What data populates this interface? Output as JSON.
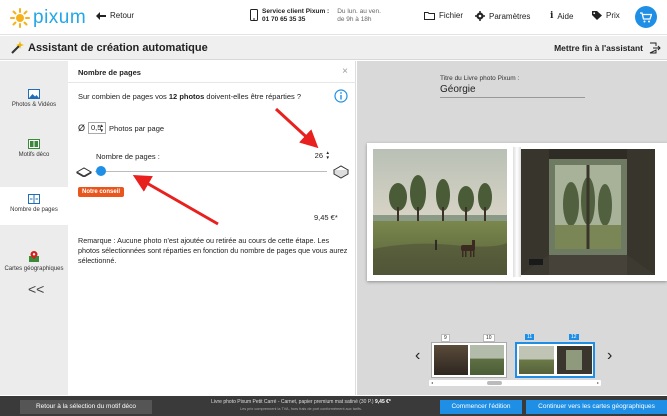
{
  "topbar": {
    "logo_text": "pixum",
    "back_label": "Retour",
    "service_title": "Service client Pixum :",
    "service_phone": "01 70 65 35 35",
    "service_days": "Du lun. au ven.",
    "service_hours": "de 9h à 18h",
    "file_label": "Fichier",
    "settings_label": "Paramètres",
    "help_label": "Aide",
    "price_label": "Prix"
  },
  "titlebar": {
    "title": "Assistant de création automatique",
    "end_label": "Mettre fin à l'assistant"
  },
  "sidebar": {
    "items": [
      {
        "label": "Photos & Vidéos"
      },
      {
        "label": "Motifs déco"
      },
      {
        "label": "Nombre de pages"
      },
      {
        "label": "Cartes géographiques"
      }
    ],
    "collapse": "<<"
  },
  "panel": {
    "title": "Nombre de pages",
    "close": "×",
    "question_pre": "Sur combien de pages vos ",
    "question_bold": "12 photos",
    "question_post": " doivent-elles être réparties ?",
    "phi": "Ø",
    "photos_per_page_value": "0,5",
    "photos_per_page_label": "Photos par page",
    "pages_label": "Nombre de pages :",
    "pages_value": "26",
    "conseil_badge": "Notre conseil",
    "price": "9,45 €*",
    "remark": "Remarque : Aucune photo n'est ajoutée ou retirée au cours de cette étape. Les photos sélectionnées sont réparties en fonction du nombre de pages que vous aurez sélectionné."
  },
  "preview": {
    "title_label": "Titre du Livre photo Pixum :",
    "title_value": "Géorgie",
    "thumb_numbers": [
      "9",
      "10",
      "11",
      "12"
    ],
    "nav_prev": "‹",
    "nav_next": "›"
  },
  "bottombar": {
    "back_button": "Retour à la sélection du motif déco",
    "product_line": "Livre photo Pixum Petit Carré - Carnet, papier premium mat satiné (30 P.)",
    "product_price": "9,45 €*",
    "tax_note": "Les prix comprennent la TVA, hors frais de port conformément aux tarifs.",
    "start_button": "Commencer l'édition",
    "continue_button": "Continuer vers les cartes géographiques"
  },
  "colors": {
    "accent": "#1f8fe6",
    "logo": "#22a7e8",
    "conseil": "#e8561e",
    "annotation": "#e8201e"
  }
}
